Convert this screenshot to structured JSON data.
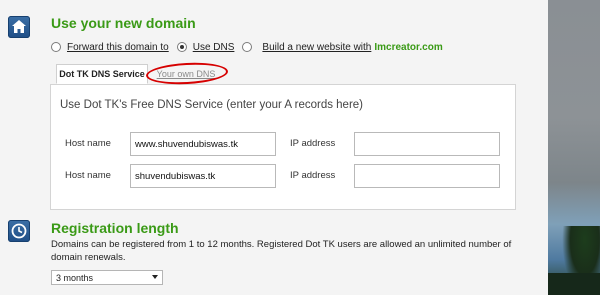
{
  "domain_section": {
    "heading": "Use your new domain",
    "icon": "home-icon",
    "options": [
      {
        "label": "Forward this domain to",
        "checked": false
      },
      {
        "label": "Use DNS",
        "checked": true
      },
      {
        "label": "Build a new website with",
        "checked": false
      }
    ],
    "builder_brand": "Imcreator.com"
  },
  "tabs": [
    {
      "label": "Dot TK DNS Service",
      "active": true
    },
    {
      "label": "Your own DNS",
      "active": false
    }
  ],
  "dns_panel": {
    "title": "Use Dot TK's Free DNS Service (enter your A records here)",
    "host_label": "Host name",
    "ip_label": "IP address",
    "rows": [
      {
        "host": "www.shuvendubiswas.tk",
        "ip": ""
      },
      {
        "host": "shuvendubiswas.tk",
        "ip": ""
      }
    ]
  },
  "registration": {
    "heading": "Registration length",
    "icon": "clock-icon",
    "description": "Domains can be registered from 1 to 12 months. Registered Dot TK users are allowed an unlimited number of domain renewals.",
    "selected": "3 months"
  },
  "colors": {
    "heading_green": "#3a9a16",
    "annotation_red": "#d60000",
    "icon_blue": "#2a5c94"
  }
}
